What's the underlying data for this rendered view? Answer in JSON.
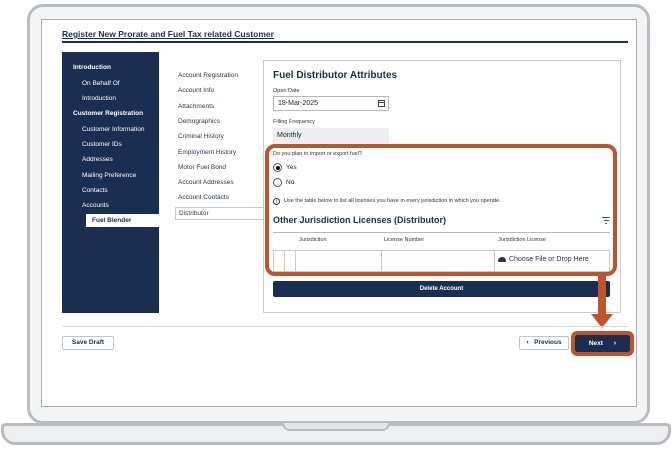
{
  "page": {
    "title": "Register New Prorate and Fuel Tax related Customer"
  },
  "left_nav": {
    "items": [
      {
        "label": "Introduction",
        "type": "header"
      },
      {
        "label": "On Behalf Of",
        "type": "sub"
      },
      {
        "label": "Introduction",
        "type": "sub"
      },
      {
        "label": "Customer Registration",
        "type": "header"
      },
      {
        "label": "Customer Information",
        "type": "sub"
      },
      {
        "label": "Customer IDs",
        "type": "sub"
      },
      {
        "label": "Addresses",
        "type": "sub"
      },
      {
        "label": "Mailing Preference",
        "type": "sub"
      },
      {
        "label": "Contacts",
        "type": "sub"
      },
      {
        "label": "Accounts",
        "type": "sub"
      },
      {
        "label": "Fuel Blender",
        "type": "selected"
      }
    ]
  },
  "section_nav": {
    "items": [
      "Account Registration",
      "Account Info",
      "Attachments",
      "Demographics",
      "Criminal History",
      "Employment History",
      "Motor Fuel Bond",
      "Account Addresses",
      "Account Contacts",
      "Distributor"
    ],
    "active": "Distributor"
  },
  "form": {
    "section_title": "Fuel Distributor Attributes",
    "open_date_label": "Open Date",
    "open_date_value": "18-Mar-2025",
    "filing_frequency_label": "Filling Frequency",
    "filing_frequency_value": "Monthly",
    "import_export_question": "Do you plan to import or export fuel?",
    "option_yes": "Yes",
    "option_no": "No",
    "selected_option": "Yes",
    "info_text": "Use the table below to list all licenses you have in every jurisdiction in which you operate.",
    "licenses_title": "Other Jurisdiction Licenses (Distributor)",
    "table_headers": [
      "Jurisdiction",
      "License Number",
      "Jurisdiction License"
    ],
    "upload_label": "Choose File or Drop Here",
    "delete_label": "Delete Account"
  },
  "footer": {
    "save_draft_label": "Save Draft",
    "previous_label": "Previous",
    "next_label": "Next"
  },
  "icons": {
    "calendar": "calendar-icon",
    "info": "info-icon",
    "filter": "filter-icon",
    "upload": "cloud-upload-icon",
    "chevron_left": "‹",
    "chevron_right": "›"
  },
  "colors": {
    "navy": "#1a2e52",
    "highlight": "#c1532b"
  }
}
